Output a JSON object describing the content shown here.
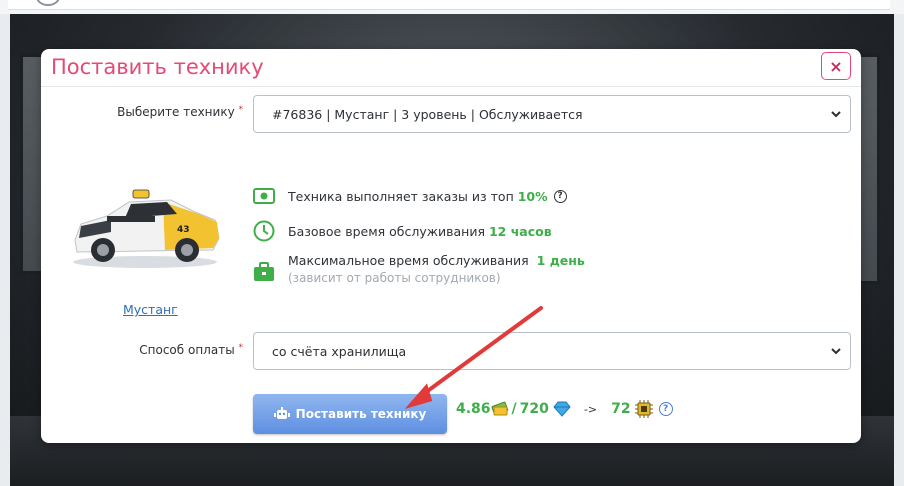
{
  "modal": {
    "title": "Поставить технику",
    "close_label": "×"
  },
  "equipment": {
    "label": "Выберите технику",
    "required_mark": "*",
    "selected": "#76836 | Мустанг | 3 уровень | Обслуживается"
  },
  "car": {
    "name_link": "Мустанг",
    "badge_number": "43"
  },
  "info": {
    "orders_text": "Техника выполняет заказы из топ",
    "orders_value": "10%",
    "orders_help": "?",
    "base_time_text": "Базовое время обслуживания",
    "base_time_value": "12 часов",
    "max_time_text": "Максимальное время обслуживания",
    "max_time_value": "1 день",
    "max_time_note": "(зависит от работы сотрудников)"
  },
  "payment": {
    "label": "Способ оплаты",
    "required_mark": "*",
    "selected": "со счёта хранилища"
  },
  "action": {
    "submit_label": "Поставить технику",
    "cost_money": "4.86",
    "slash": "/",
    "cost_gems": "720",
    "arrow": "->",
    "result_chips": "72",
    "help": "?"
  },
  "colors": {
    "title": "#e54a76",
    "accent_green": "#3fae49",
    "button": "#5e8fe0"
  }
}
